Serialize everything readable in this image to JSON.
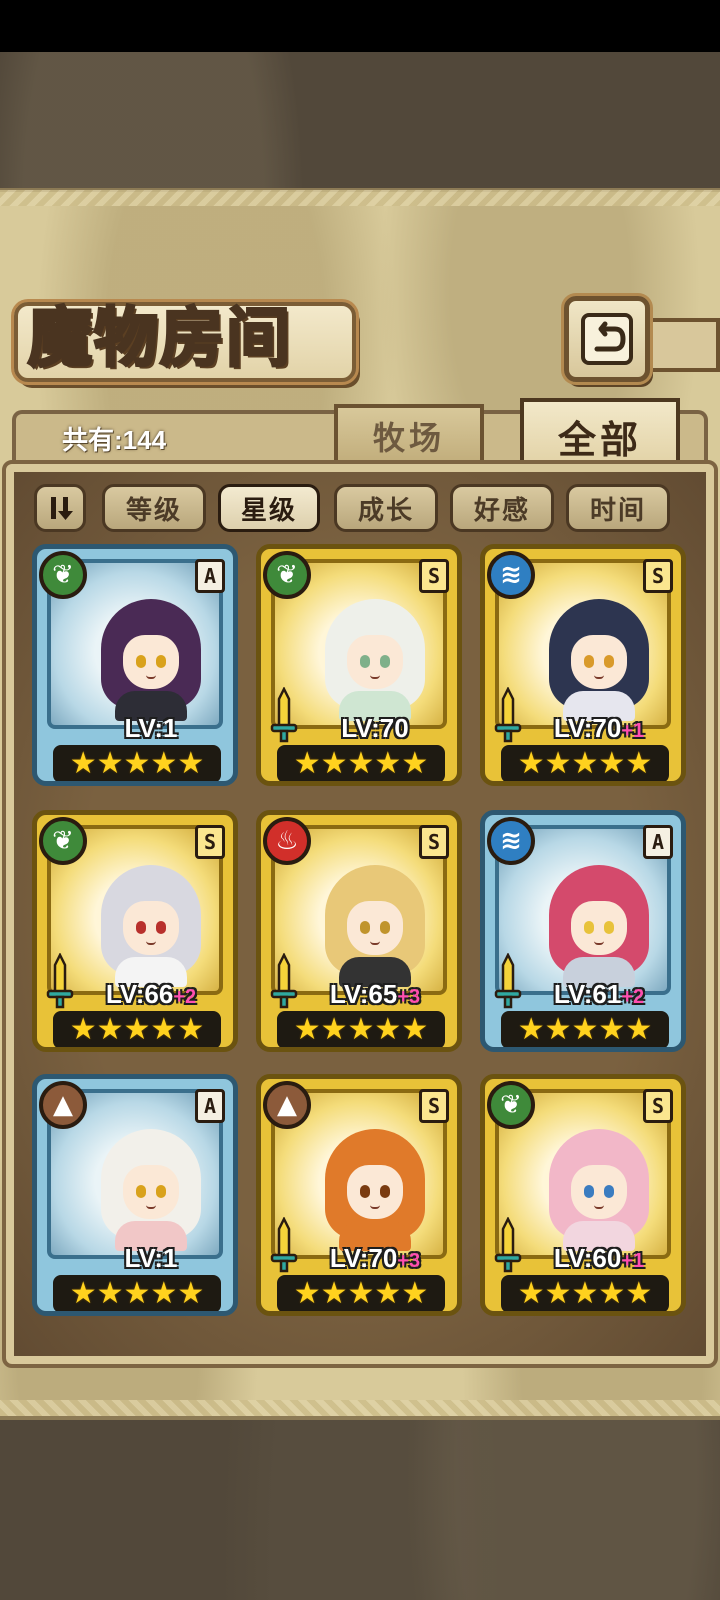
{
  "page": {
    "title": "魔物房间",
    "count_label": "共有:144"
  },
  "tabs": {
    "farm": "牧场",
    "all": "全部",
    "active": "all"
  },
  "sort": {
    "options": [
      "等级",
      "星级",
      "成长",
      "好感",
      "时间"
    ],
    "active": "星级"
  },
  "colors": {
    "panel": "#d8ca9a",
    "frame_dark": "#6c5435",
    "rank_a_card": "#8fc6dd",
    "rank_s_card": "#e8c238",
    "bonus_text": "#ff4fb0"
  },
  "monsters": [
    {
      "element": "leaf-icon",
      "rank": "A",
      "level": "LV:1",
      "bonus": "",
      "stars": "★★★★★",
      "has_weapon": false
    },
    {
      "element": "leaf-icon",
      "rank": "S",
      "level": "LV:70",
      "bonus": "",
      "stars": "★★★★★",
      "has_weapon": true
    },
    {
      "element": "water-icon",
      "rank": "S",
      "level": "LV:70",
      "bonus": "+1",
      "stars": "★★★★★",
      "has_weapon": true
    },
    {
      "element": "leaf-icon",
      "rank": "S",
      "level": "LV:66",
      "bonus": "+2",
      "stars": "★★★★★",
      "has_weapon": true
    },
    {
      "element": "fire-icon",
      "rank": "S",
      "level": "LV:65",
      "bonus": "+3",
      "stars": "★★★★★",
      "has_weapon": true
    },
    {
      "element": "water-icon",
      "rank": "A",
      "level": "LV:61",
      "bonus": "+2",
      "stars": "★★★★★",
      "has_weapon": true
    },
    {
      "element": "earth-icon",
      "rank": "A",
      "level": "LV:1",
      "bonus": "",
      "stars": "★★★★★",
      "has_weapon": false
    },
    {
      "element": "earth-icon",
      "rank": "S",
      "level": "LV:70",
      "bonus": "+3",
      "stars": "★★★★★",
      "has_weapon": true
    },
    {
      "element": "leaf-icon",
      "rank": "S",
      "level": "LV:60",
      "bonus": "+1",
      "stars": "★★★★★",
      "has_weapon": true
    }
  ]
}
